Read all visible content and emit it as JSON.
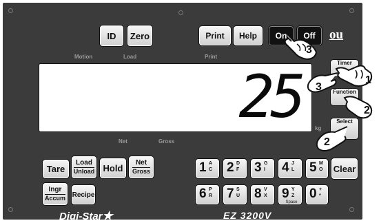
{
  "top_keys": {
    "id": "ID",
    "zero": "Zero",
    "print": "Print",
    "help": "Help",
    "on": "On",
    "off": "Off",
    "ou": "ou"
  },
  "labels": {
    "motion": "Motion",
    "load": "Load",
    "print": "Print",
    "net": "Net",
    "gross": "Gross",
    "kg": "kg"
  },
  "display": {
    "value": "25"
  },
  "side_keys": {
    "timer": "Timer",
    "function": "Function",
    "select": "Select"
  },
  "left_keys": {
    "tare": "Tare",
    "load_top": "Load",
    "load_bottom": "Unload",
    "hold": "Hold",
    "net_top": "Net",
    "net_bottom": "Gross",
    "ingr_top": "Ingr",
    "ingr_bottom": "Accum",
    "recipe": "Recipe"
  },
  "numpad": [
    {
      "digit": "1",
      "top": "A",
      "bot": "C"
    },
    {
      "digit": "2",
      "top": "D",
      "bot": "F"
    },
    {
      "digit": "3",
      "top": "G",
      "bot": "I"
    },
    {
      "digit": "4",
      "top": "J",
      "bot": "L"
    },
    {
      "digit": "5",
      "top": "M",
      "bot": "O"
    },
    {
      "digit": "6",
      "top": "P",
      "bot": "R"
    },
    {
      "digit": "7",
      "top": "S",
      "bot": "U"
    },
    {
      "digit": "8",
      "top": "V",
      "bot": "X"
    },
    {
      "digit": "9",
      "top": "Y",
      "bot": "Z",
      "extra": "Space"
    },
    {
      "digit": "0",
      "top": "+",
      "bot": "*"
    }
  ],
  "clear": "Clear",
  "brand": "Digi-Star",
  "model": "EZ 3200V",
  "callouts": [
    "3",
    "3",
    "1",
    "2",
    "2"
  ]
}
